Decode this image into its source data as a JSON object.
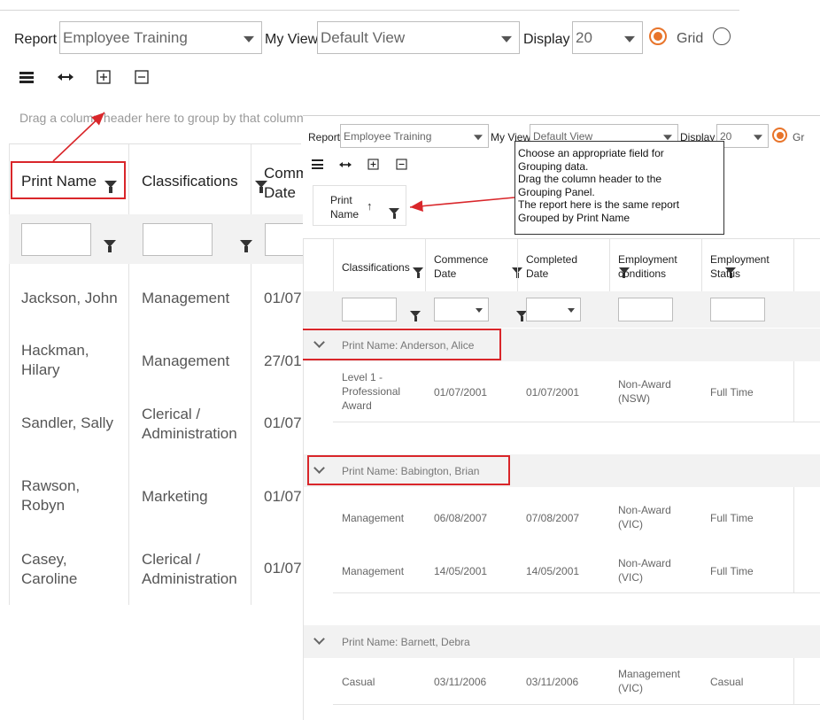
{
  "back": {
    "toolbar": {
      "report_label": "Report",
      "report_value": "Employee Training",
      "myview_label": "My View",
      "myview_value": "Default View",
      "display_label": "Display",
      "display_value": "20",
      "grid_label": "Grid"
    },
    "group_panel_hint": "Drag a column header here to group by that column",
    "columns": [
      "Print Name",
      "Classifications",
      "Commence Date"
    ],
    "rows": [
      {
        "name": "Jackson, John",
        "classification": "Management",
        "commence": "01/07"
      },
      {
        "name": "Hackman, Hilary",
        "classification": "Management",
        "commence": "27/01"
      },
      {
        "name": "Sandler, Sally",
        "classification": "Clerical / Administration",
        "commence": "01/07"
      },
      {
        "name": "Rawson, Robyn",
        "classification": "Marketing",
        "commence": "01/07"
      },
      {
        "name": "Casey, Caroline",
        "classification": "Clerical / Administration",
        "commence": "01/07"
      }
    ]
  },
  "front": {
    "toolbar": {
      "report_label": "Report",
      "report_value": "Employee Training",
      "myview_label": "My View",
      "myview_value": "Default View",
      "display_label": "Display",
      "display_value": "20",
      "grid_label": "Gr"
    },
    "grouped_chip": "Print Name",
    "columns": [
      "Classifications",
      "Commence Date",
      "Completed Date",
      "Employment conditions",
      "Employment Status"
    ],
    "groups": [
      {
        "title": "Print Name: Anderson, Alice",
        "rows": [
          {
            "classification": "Level 1 - Professional Award",
            "commence": "01/07/2001",
            "completed": "01/07/2001",
            "conditions": "Non-Award (NSW)",
            "status": "Full Time"
          }
        ]
      },
      {
        "title": "Print Name: Babington, Brian",
        "rows": [
          {
            "classification": "Management",
            "commence": "06/08/2007",
            "completed": "07/08/2007",
            "conditions": "Non-Award (VIC)",
            "status": "Full Time"
          },
          {
            "classification": "Management",
            "commence": "14/05/2001",
            "completed": "14/05/2001",
            "conditions": "Non-Award (VIC)",
            "status": "Full Time"
          }
        ]
      },
      {
        "title": "Print Name: Barnett, Debra",
        "rows": [
          {
            "classification": "Casual",
            "commence": "03/11/2006",
            "completed": "03/11/2006",
            "conditions": "Management (VIC)",
            "status": "Casual"
          }
        ]
      }
    ]
  },
  "callout": {
    "lines": [
      "Choose an appropriate field for",
      "Grouping data.",
      "Drag the column header to the",
      "Grouping Panel.",
      "The report here is the same report",
      "Grouped by Print Name"
    ]
  },
  "colors": {
    "accent_orange": "#e8742a",
    "annotation_red": "#d9262a"
  }
}
